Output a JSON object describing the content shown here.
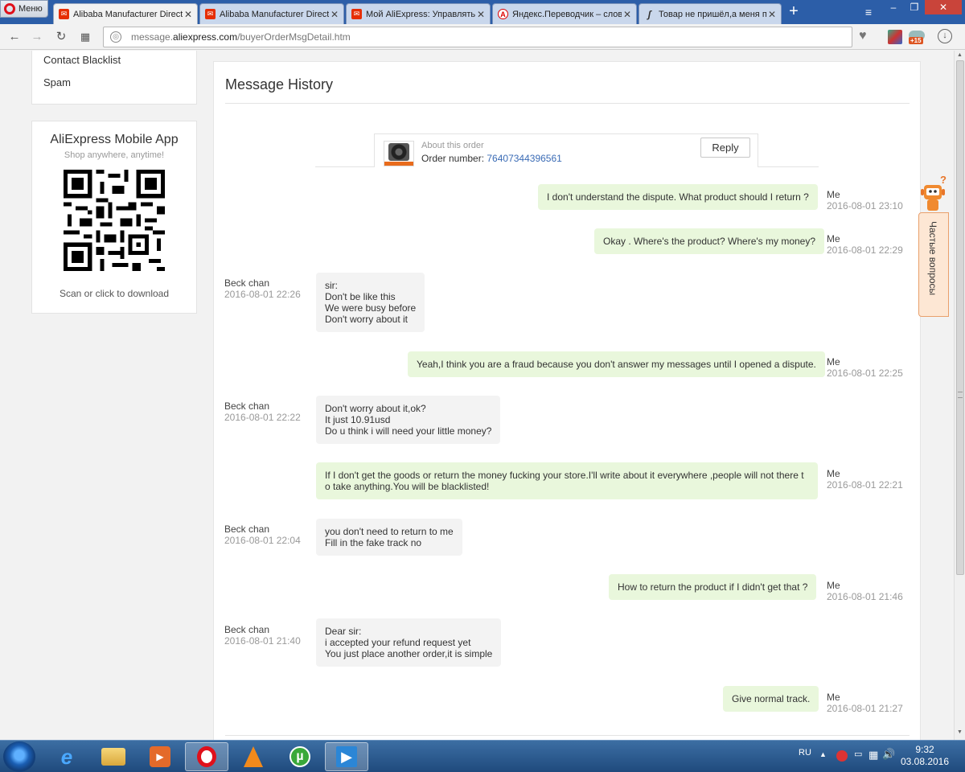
{
  "browser": {
    "menu_label": "Меню",
    "tabs": [
      {
        "title": "Alibaba Manufacturer Directo",
        "icon": "aliexpress-icon",
        "active": true
      },
      {
        "title": "Alibaba Manufacturer Directo",
        "icon": "aliexpress-icon",
        "active": false
      },
      {
        "title": "Мой AliExpress: Управлять з",
        "icon": "aliexpress-icon",
        "active": false
      },
      {
        "title": "Яндекс.Переводчик – слова",
        "icon": "yandex-translate-icon",
        "active": false
      },
      {
        "title": "Товар не пришёл,а меня пр",
        "icon": "forum-icon",
        "active": false
      }
    ],
    "url_prefix": "message.",
    "url_domain": "aliexpress.com",
    "url_path": "/buyerOrderMsgDetail.htm",
    "ext_badge": "+15"
  },
  "sidebar": {
    "links": [
      "Contact Blacklist",
      "Spam"
    ],
    "app": {
      "title": "AliExpress Mobile App",
      "subtitle": "Shop anywhere, anytime!",
      "download": "Scan or click to download"
    }
  },
  "main": {
    "title": "Message History",
    "order": {
      "about": "About this order",
      "number_label": "Order number: ",
      "number": "76407344396561",
      "reply_label": "Reply"
    },
    "messages": [
      {
        "side": "me",
        "who": "Me",
        "when": "2016-08-01 23:10",
        "lines": [
          "I don't understand the dispute. What product should I return ?"
        ]
      },
      {
        "side": "me",
        "who": "Me",
        "when": "2016-08-01 22:29",
        "lines": [
          "Okay . Where's the product? Where's my money?"
        ]
      },
      {
        "side": "them",
        "who": "Beck chan",
        "when": "2016-08-01 22:26",
        "lines": [
          "sir:",
          "Don't be like this",
          "We were busy before",
          "Don't worry about it"
        ]
      },
      {
        "side": "me",
        "who": "Me",
        "when": "2016-08-01 22:25",
        "lines": [
          "Yeah,I think you are a fraud because you don't answer my messages until I opened a dispute."
        ]
      },
      {
        "side": "them",
        "who": "Beck chan",
        "when": "2016-08-01 22:22",
        "lines": [
          "Don't worry about it,ok?",
          "It just 10.91usd",
          "Do u think i will need your little money?"
        ]
      },
      {
        "side": "me",
        "who": "Me",
        "when": "2016-08-01 22:21",
        "lines": [
          "If I don't get the goods or return the money fucking your store.I'll write about it everywhere ,people will not there t",
          "o take anything.You will be blacklisted!"
        ]
      },
      {
        "side": "them",
        "who": "Beck chan",
        "when": "2016-08-01 22:04",
        "lines": [
          "you don't need to return to me",
          "Fill in the fake track no"
        ]
      },
      {
        "side": "me",
        "who": "Me",
        "when": "2016-08-01 21:46",
        "lines": [
          "How to return the product if I didn't get that ?"
        ]
      },
      {
        "side": "them",
        "who": "Beck chan",
        "when": "2016-08-01 21:40",
        "lines": [
          "Dear sir:",
          "i accepted your refund request yet",
          "You just place another order,it is simple"
        ]
      },
      {
        "side": "me",
        "who": "Me",
        "when": "2016-08-01 21:27",
        "lines": [
          "Give normal track."
        ]
      }
    ]
  },
  "faq": {
    "label": "Частые вопросы"
  },
  "taskbar": {
    "lang": "RU",
    "time": "9:32",
    "date": "03.08.2016"
  }
}
